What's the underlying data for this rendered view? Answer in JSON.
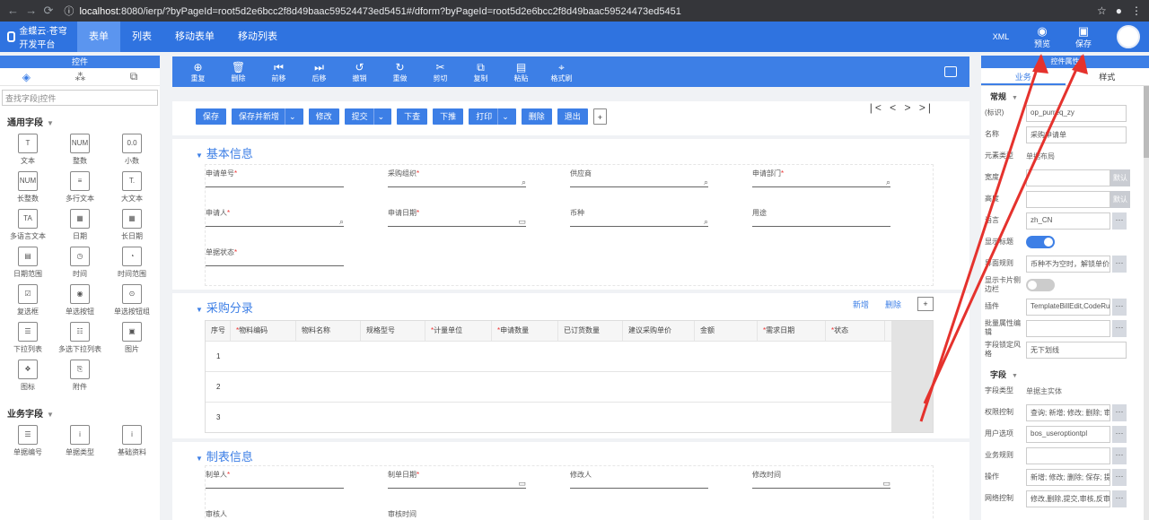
{
  "browser": {
    "host": "localhost",
    "url_rest": ":8080/ierp/?byPageId=root5d2e6bcc2f8d49baac59524473ed5451#/dform?byPageId=root5d2e6bcc2f8d49baac59524473ed5451"
  },
  "topnav": {
    "logo": "金蝶云·苍穹 开发平台",
    "tabs": [
      "表单",
      "列表",
      "移动表单",
      "移动列表"
    ],
    "xml": "XML",
    "preview": "预览",
    "save": "保存"
  },
  "left": {
    "title": "控件",
    "search_placeholder": "查找字段|控件",
    "group1": "通用字段",
    "items1": [
      {
        "icon": "T",
        "label": "文本"
      },
      {
        "icon": "NUM",
        "label": "整数"
      },
      {
        "icon": "0.0",
        "label": "小数"
      },
      {
        "icon": "NUM",
        "label": "长整数"
      },
      {
        "icon": "≡",
        "label": "多行文本"
      },
      {
        "icon": "T.",
        "label": "大文本"
      },
      {
        "icon": "TA",
        "label": "多语言文本"
      },
      {
        "icon": "▦",
        "label": "日期"
      },
      {
        "icon": "▦",
        "label": "长日期"
      },
      {
        "icon": "▤",
        "label": "日期范围"
      },
      {
        "icon": "◷",
        "label": "时间"
      },
      {
        "icon": "◔",
        "label": "时间范围"
      },
      {
        "icon": "☑",
        "label": "复选框"
      },
      {
        "icon": "◉",
        "label": "单选按钮"
      },
      {
        "icon": "⊙",
        "label": "单选按钮组"
      },
      {
        "icon": "☰",
        "label": "下拉列表"
      },
      {
        "icon": "☷",
        "label": "多选下拉列表"
      },
      {
        "icon": "▣",
        "label": "图片"
      },
      {
        "icon": "❖",
        "label": "图标"
      },
      {
        "icon": "⎘",
        "label": "附件"
      }
    ],
    "group2": "业务字段",
    "items2": [
      {
        "icon": "☰",
        "label": "单据编号"
      },
      {
        "icon": "i",
        "label": "单据类型"
      },
      {
        "icon": "i",
        "label": "基础资料"
      }
    ]
  },
  "toolbar": [
    "重复",
    "删除",
    "前移",
    "后移",
    "撤销",
    "重做",
    "剪切",
    "复制",
    "粘贴",
    "格式刷"
  ],
  "form": {
    "actions": [
      "保存",
      "保存并新增",
      "修改",
      "提交",
      "下查",
      "下推",
      "打印",
      "删除",
      "退出"
    ],
    "pager": "|< < > >|",
    "basic": {
      "title": "基本信息",
      "fields": [
        {
          "label": "申请单号",
          "req": "*",
          "icon": ""
        },
        {
          "label": "采购组织",
          "req": "*",
          "icon": "⌕"
        },
        {
          "label": "供应商",
          "req": "",
          "icon": "⌕"
        },
        {
          "label": "申请部门",
          "req": "*",
          "icon": "⌕"
        },
        {
          "label": "申请人",
          "req": "*",
          "icon": "⌕"
        },
        {
          "label": "申请日期",
          "req": "*",
          "icon": "▭"
        },
        {
          "label": "币种",
          "req": "",
          "icon": "⌕"
        },
        {
          "label": "用途",
          "req": "",
          "icon": ""
        },
        {
          "label": "单据状态",
          "req": "*",
          "icon": ""
        }
      ]
    },
    "entry": {
      "title": "采购分录",
      "add": "新增",
      "delete": "删除",
      "columns": [
        {
          "label": "序号",
          "req": ""
        },
        {
          "label": "物料编码",
          "req": "*"
        },
        {
          "label": "物料名称",
          "req": ""
        },
        {
          "label": "规格型号",
          "req": ""
        },
        {
          "label": "计量单位",
          "req": "*"
        },
        {
          "label": "申请数量",
          "req": "*"
        },
        {
          "label": "已订货数量",
          "req": ""
        },
        {
          "label": "建议采购单价",
          "req": ""
        },
        {
          "label": "金额",
          "req": ""
        },
        {
          "label": "需求日期",
          "req": "*"
        },
        {
          "label": "状态",
          "req": "*"
        }
      ],
      "rows": [
        "1",
        "2",
        "3"
      ]
    },
    "maker": {
      "title": "制表信息",
      "fields": [
        {
          "label": "制单人",
          "req": "*",
          "icon": ""
        },
        {
          "label": "制单日期",
          "req": "*",
          "icon": "▭"
        },
        {
          "label": "修改人",
          "req": "",
          "icon": ""
        },
        {
          "label": "修改时间",
          "req": "",
          "icon": "▭"
        },
        {
          "label": "审核人",
          "req": "",
          "icon": ""
        },
        {
          "label": "审核时间",
          "req": "",
          "icon": ""
        }
      ]
    }
  },
  "right": {
    "title": "控件属性",
    "tabs": [
      "业务",
      "样式"
    ],
    "group1": "常规",
    "props": [
      {
        "label": "(标识)",
        "value": "op_purreq_zy",
        "kind": "input"
      },
      {
        "label": "名称",
        "value": "采购申请单",
        "kind": "input"
      },
      {
        "label": "元素类型",
        "value": "单据布局",
        "kind": "text"
      },
      {
        "label": "宽度",
        "value": "",
        "kind": "default",
        "btn": "默认"
      },
      {
        "label": "高度",
        "value": "",
        "kind": "default",
        "btn": "默认"
      },
      {
        "label": "语言",
        "value": "zh_CN",
        "kind": "more"
      },
      {
        "label": "显示标题",
        "value": "",
        "kind": "toggle-on"
      },
      {
        "label": "界面规则",
        "value": "币种不为空时，解锁单价，变",
        "kind": "more"
      },
      {
        "label": "显示卡片侧边栏",
        "value": "",
        "kind": "toggle-off"
      },
      {
        "label": "插件",
        "value": "TemplateBillEdit,CodeRule",
        "kind": "more"
      },
      {
        "label": "批量属性编辑",
        "value": "",
        "kind": "more"
      },
      {
        "label": "字段锁定风格",
        "value": "无下划线",
        "kind": "select"
      }
    ],
    "group2": "字段",
    "props2": [
      {
        "label": "字段类型",
        "value": "单据主实体",
        "kind": "text"
      },
      {
        "label": "权限控制",
        "value": "查询; 新增; 修改; 删除; 审核;",
        "kind": "more"
      },
      {
        "label": "用户选项",
        "value": "bos_useroptiontpl",
        "kind": "more"
      },
      {
        "label": "业务规则",
        "value": "",
        "kind": "more"
      },
      {
        "label": "操作",
        "value": "新增; 修改; 删除; 保存; 提交;",
        "kind": "more"
      },
      {
        "label": "网络控制",
        "value": "修改,删除,提交,审核,反审核,",
        "kind": "more"
      }
    ]
  },
  "colors": {
    "brand": "#2f73e0",
    "accent": "#3d7fe6",
    "arrow": "#e5322d"
  }
}
